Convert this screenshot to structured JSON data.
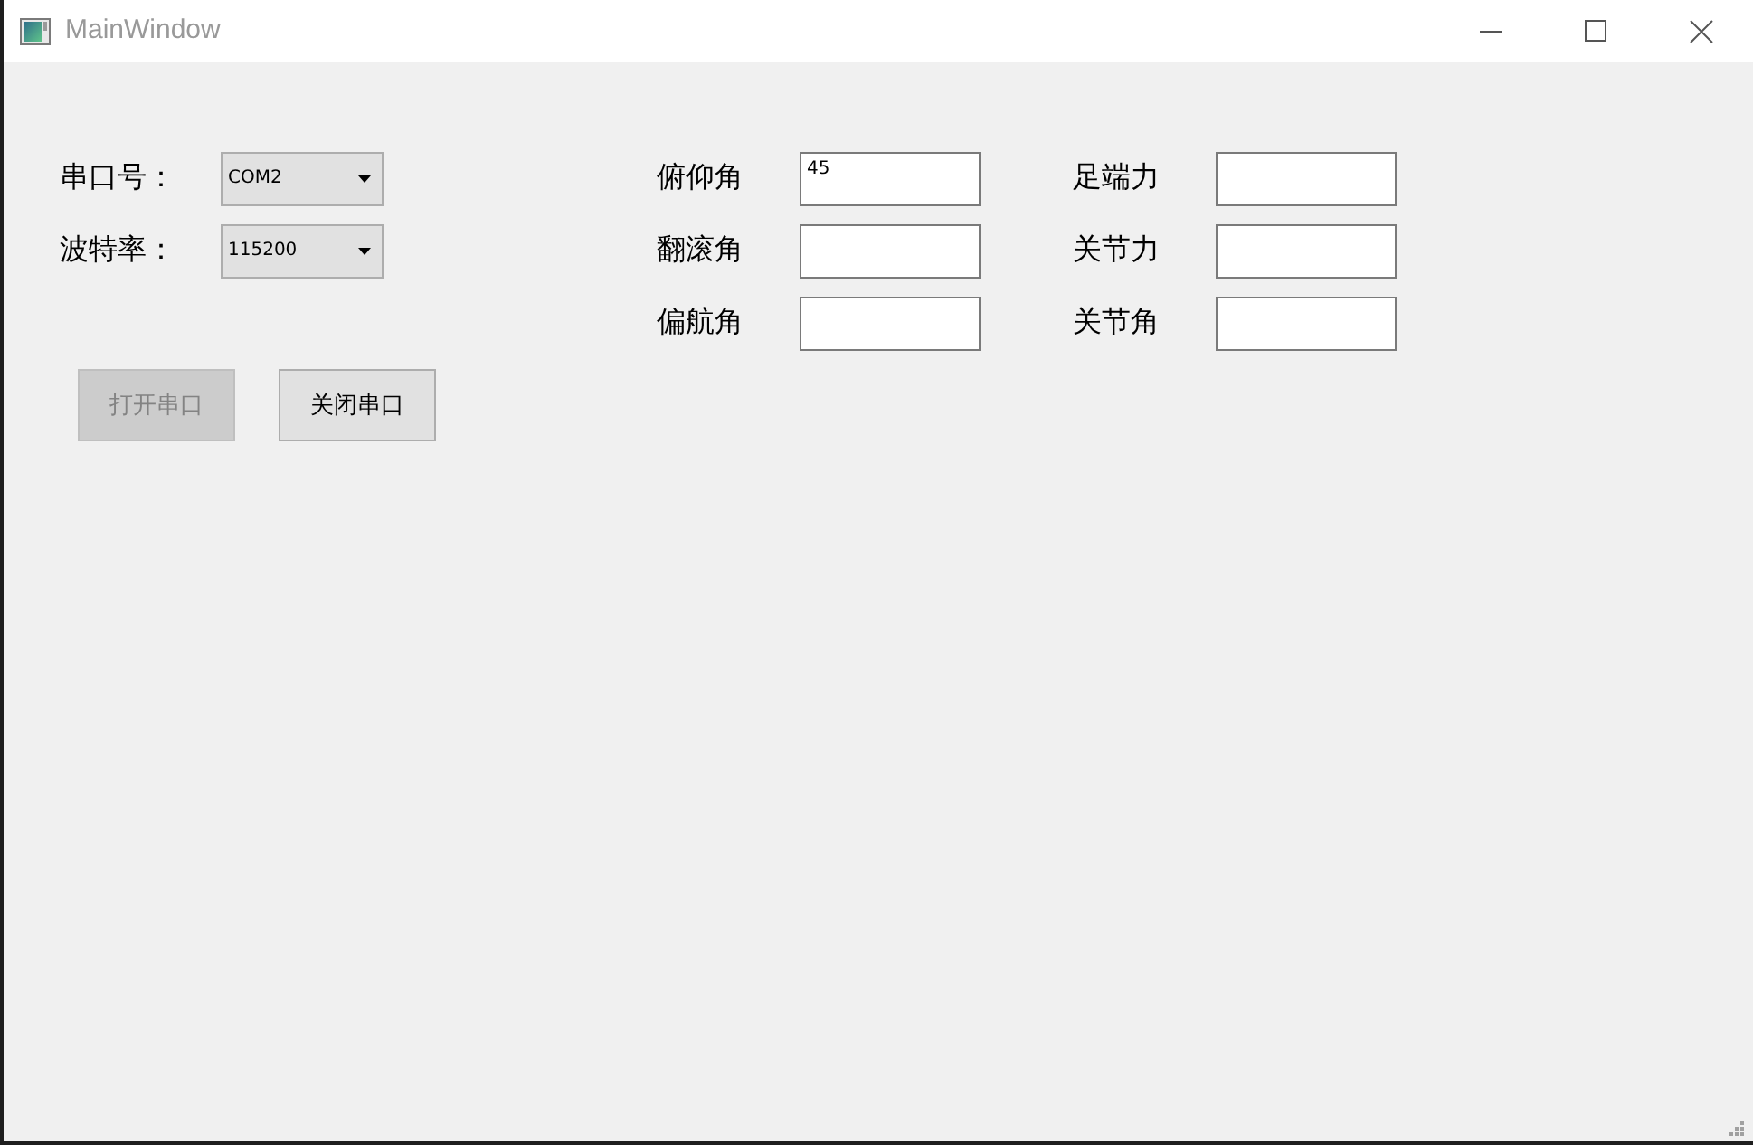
{
  "window": {
    "title": "MainWindow"
  },
  "serial": [
    {
      "label": "串口号：",
      "value": "COM2"
    },
    {
      "label": "波特率：",
      "value": "115200"
    }
  ],
  "buttons": [
    {
      "label": "打开串口",
      "disabled": true
    },
    {
      "label": "关闭串口",
      "disabled": false
    }
  ],
  "readings": [
    {
      "label": "俯仰角",
      "value": "45"
    },
    {
      "label": "足端力"
    },
    {
      "label": "翻滚角"
    },
    {
      "label": "关节力"
    },
    {
      "label": "偏航角"
    },
    {
      "label": "关节角"
    }
  ]
}
